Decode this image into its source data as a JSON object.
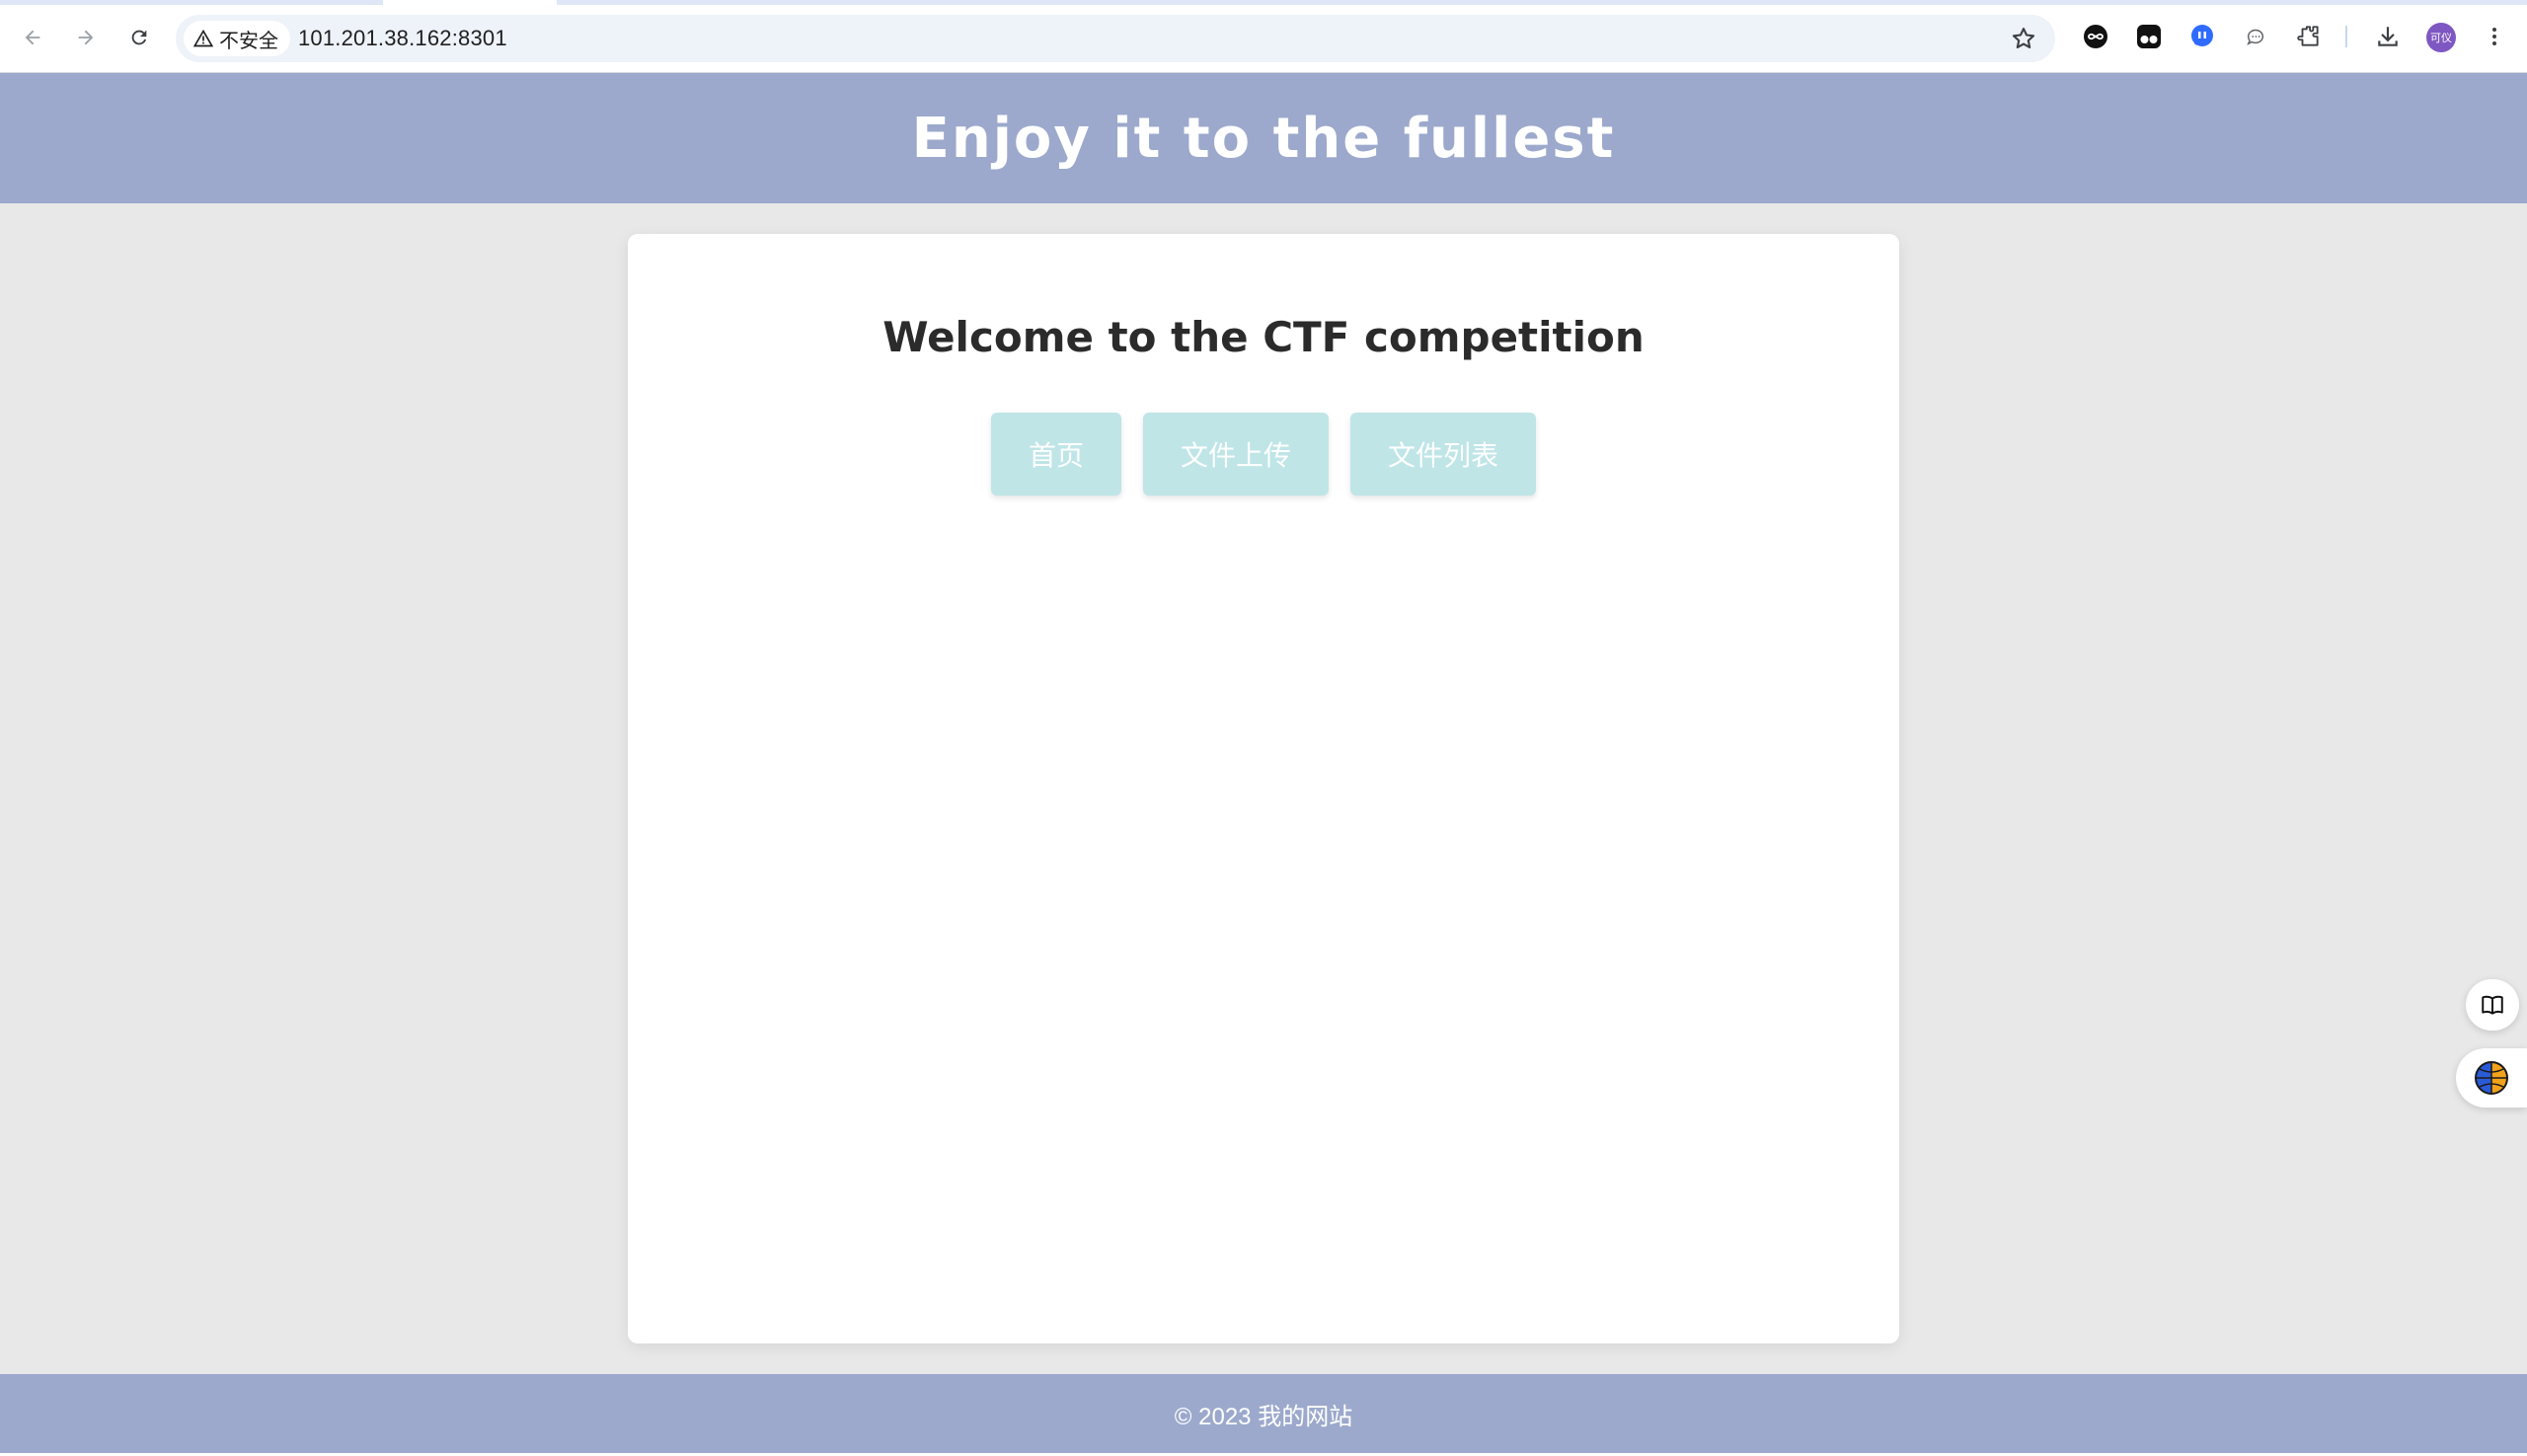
{
  "browser": {
    "security_label": "不安全",
    "url": "101.201.38.162:8301",
    "avatar_text": "可仪",
    "icons": {
      "back": "back-arrow-icon",
      "forward": "forward-arrow-icon",
      "reload": "reload-icon",
      "warning": "warning-triangle-icon",
      "bookmark": "star-icon",
      "extensions": [
        "infinity-extension-icon",
        "tampermonkey-extension-icon",
        "chat-extension-icon",
        "speech-bubble-icon",
        "puzzle-extensions-icon"
      ],
      "download": "download-icon",
      "menu": "kebab-menu-icon"
    }
  },
  "header": {
    "title": "Enjoy it to the fullest"
  },
  "main": {
    "title": "Welcome to the CTF competition",
    "buttons": [
      {
        "label": "首页"
      },
      {
        "label": "文件上传"
      },
      {
        "label": "文件列表"
      }
    ]
  },
  "footer": {
    "text": "© 2023 我的网站"
  },
  "side_widgets": [
    "book-icon",
    "globe-translate-icon"
  ],
  "colors": {
    "header_bg": "#9ca9cc",
    "page_bg": "#e8e8e8",
    "button_bg": "#bfe5e7",
    "title_text": "#2b2b2b"
  }
}
